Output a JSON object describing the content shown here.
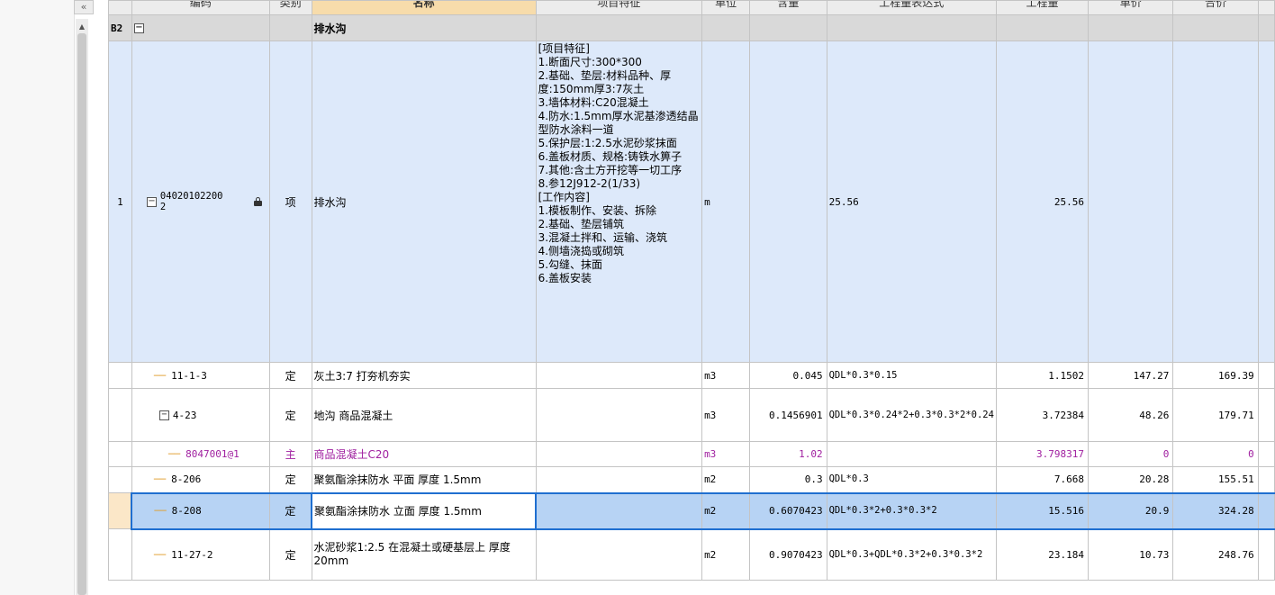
{
  "collapse_glyph": "«",
  "header": {
    "code": "编码",
    "category": "类别",
    "name": "名称",
    "feature": "项目特征",
    "unit": "单位",
    "content": "含量",
    "expression": "工程量表达式",
    "quantity": "工程量",
    "unit_price": "单价",
    "total": "合价"
  },
  "group": {
    "index": "B2",
    "name": "排水沟",
    "toggle": "−"
  },
  "item": {
    "index": "1",
    "code_line1": "04020102200",
    "code_line2": "2",
    "category": "项",
    "name": "排水沟",
    "unit": "m",
    "expression": "25.56",
    "quantity": "25.56",
    "feature": "[项目特征]\n1.断面尺寸:300*300\n2.基础、垫层:材料品种、厚度:150mm厚3:7灰土\n3.墙体材料:C20混凝土\n4.防水:1.5mm厚水泥基渗透结晶型防水涂料一道\n5.保护层:1:2.5水泥砂浆抹面\n6.盖板材质、规格:铸铁水箅子\n7.其他:含土方开挖等一切工序\n8.参12J912-2(1/33)\n[工作内容]\n1.模板制作、安装、拆除\n2.基础、垫层铺筑\n3.混凝土拌和、运输、浇筑\n4.侧墙浇捣或砌筑\n5.勾缝、抹面\n6.盖板安装"
  },
  "rows": [
    {
      "code": "11-1-3",
      "category": "定",
      "name": "灰土3:7 打夯机夯实",
      "unit": "m3",
      "content": "0.045",
      "expression": "QDL*0.3*0.15",
      "quantity": "1.1502",
      "unit_price": "147.27",
      "total": "169.39"
    },
    {
      "code": "4-23",
      "category": "定",
      "name": "地沟 商品混凝土",
      "unit": "m3",
      "content": "0.1456901",
      "expression": "QDL*0.3*0.24*2+0.3*0.3*2*0.24",
      "quantity": "3.72384",
      "unit_price": "48.26",
      "total": "179.71"
    },
    {
      "code": "8047001@1",
      "category": "主",
      "name": "商品混凝土C20",
      "unit": "m3",
      "content": "1.02",
      "expression": "",
      "quantity": "3.798317",
      "unit_price": "0",
      "total": "0"
    },
    {
      "code": "8-206",
      "category": "定",
      "name": "聚氨酯涂抹防水 平面 厚度 1.5mm",
      "unit": "m2",
      "content": "0.3",
      "expression": "QDL*0.3",
      "quantity": "7.668",
      "unit_price": "20.28",
      "total": "155.51"
    },
    {
      "code": "8-208",
      "category": "定",
      "name": "聚氨酯涂抹防水 立面 厚度 1.5mm",
      "unit": "m2",
      "content": "0.6070423",
      "expression": "QDL*0.3*2+0.3*0.3*2",
      "quantity": "15.516",
      "unit_price": "20.9",
      "total": "324.28"
    },
    {
      "code": "11-27-2",
      "category": "定",
      "name": "水泥砂浆1:2.5 在混凝土或硬基层上 厚度 20mm",
      "unit": "m2",
      "content": "0.9070423",
      "expression": "QDL*0.3+QDL*0.3*2+0.3*0.3*2",
      "quantity": "23.184",
      "unit_price": "10.73",
      "total": "248.76"
    }
  ],
  "colors": {
    "selected": "#b7d3f4",
    "item_row": "#dde9fa",
    "group_row": "#d9d9d9",
    "material_text": "#a020a0",
    "header_highlight": "#f7dcab"
  }
}
